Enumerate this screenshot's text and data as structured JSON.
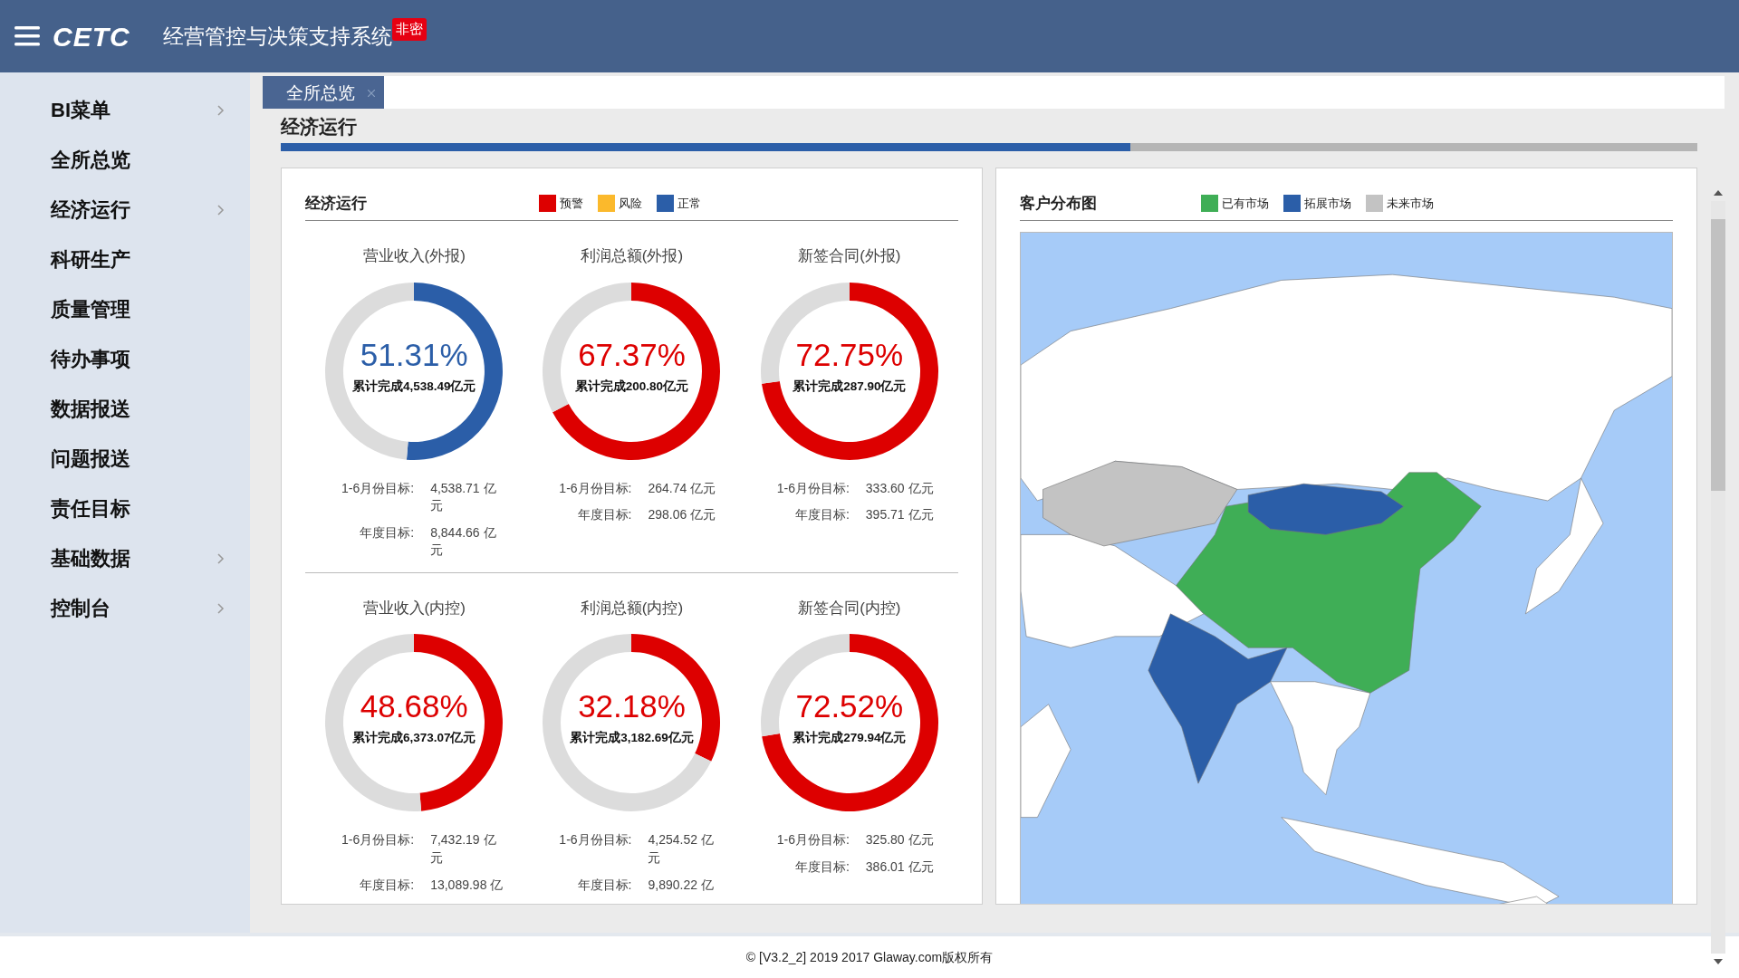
{
  "header": {
    "logo": "CETC",
    "title": "经营管控与决策支持系统",
    "badge": "非密"
  },
  "sidebar": {
    "items": [
      {
        "label": "BI菜单",
        "submenu": true
      },
      {
        "label": "全所总览",
        "submenu": false
      },
      {
        "label": "经济运行",
        "submenu": true
      },
      {
        "label": "科研生产",
        "submenu": false
      },
      {
        "label": "质量管理",
        "submenu": false
      },
      {
        "label": "待办事项",
        "submenu": false
      },
      {
        "label": "数据报送",
        "submenu": false
      },
      {
        "label": "问题报送",
        "submenu": false
      },
      {
        "label": "责任目标",
        "submenu": false
      },
      {
        "label": "基础数据",
        "submenu": true
      },
      {
        "label": "控制台",
        "submenu": true
      }
    ]
  },
  "tabs": [
    {
      "label": "全所总览",
      "selected": true
    }
  ],
  "section": {
    "title": "经济运行",
    "progress": {
      "level": 0.6
    }
  },
  "economy_panel": {
    "title": "经济运行",
    "legend": [
      {
        "label": "预警",
        "color": "#dd0000"
      },
      {
        "label": "风险",
        "color": "#fbb92c"
      },
      {
        "label": "正常",
        "color": "#2b5ea8"
      }
    ],
    "rows": [
      {
        "gauges": [
          {
            "title": "营业收入(外报)",
            "percent": "51.31%",
            "chart_data": {
              "type": "donut",
              "values": [
                51.31,
                48.69
              ]
            },
            "color": "#2b5ea8",
            "completed": "累计完成4,538.49亿元",
            "targets": [
              {
                "label": "1-6月份目标:",
                "value": "4,538.71 亿元"
              },
              {
                "label": "年度目标:",
                "value": "8,844.66 亿元"
              }
            ]
          },
          {
            "title": "利润总额(外报)",
            "percent": "67.37%",
            "chart_data": {
              "type": "donut",
              "values": [
                67.37,
                32.63
              ]
            },
            "color": "#dd0000",
            "completed": "累计完成200.80亿元",
            "targets": [
              {
                "label": "1-6月份目标:",
                "value": "264.74 亿元"
              },
              {
                "label": "年度目标:",
                "value": "298.06 亿元"
              }
            ]
          },
          {
            "title": "新签合同(外报)",
            "percent": "72.75%",
            "chart_data": {
              "type": "donut",
              "values": [
                72.75,
                27.25
              ]
            },
            "color": "#dd0000",
            "completed": "累计完成287.90亿元",
            "targets": [
              {
                "label": "1-6月份目标:",
                "value": "333.60 亿元"
              },
              {
                "label": "年度目标:",
                "value": "395.71 亿元"
              }
            ]
          }
        ]
      },
      {
        "gauges": [
          {
            "title": "营业收入(内控)",
            "percent": "48.68%",
            "chart_data": {
              "type": "donut",
              "values": [
                48.68,
                51.32
              ]
            },
            "color": "#dd0000",
            "completed": "累计完成6,373.07亿元",
            "targets": [
              {
                "label": "1-6月份目标:",
                "value": "7,432.19 亿元"
              },
              {
                "label": "年度目标:",
                "value": "13,089.98 亿"
              }
            ]
          },
          {
            "title": "利润总额(内控)",
            "percent": "32.18%",
            "chart_data": {
              "type": "donut",
              "values": [
                32.18,
                67.82
              ]
            },
            "color": "#dd0000",
            "completed": "累计完成3,182.69亿元",
            "targets": [
              {
                "label": "1-6月份目标:",
                "value": "4,254.52 亿元"
              },
              {
                "label": "年度目标:",
                "value": "9,890.22 亿"
              }
            ]
          },
          {
            "title": "新签合同(内控)",
            "percent": "72.52%",
            "chart_data": {
              "type": "donut",
              "values": [
                72.52,
                27.48
              ]
            },
            "color": "#dd0000",
            "completed": "累计完成279.94亿元",
            "targets": [
              {
                "label": "1-6月份目标:",
                "value": "325.80 亿元"
              },
              {
                "label": "年度目标:",
                "value": "386.01 亿元"
              }
            ]
          }
        ]
      }
    ]
  },
  "map_panel": {
    "title": "客户分布图",
    "legend": [
      {
        "label": "已有市场",
        "color": "#3fae56"
      },
      {
        "label": "拓展市场",
        "color": "#2b5ea8"
      },
      {
        "label": "未来市场",
        "color": "#c3c3c3"
      }
    ]
  },
  "footer": "© [V3.2_2] 2019 2017 Glaway.com版权所有"
}
